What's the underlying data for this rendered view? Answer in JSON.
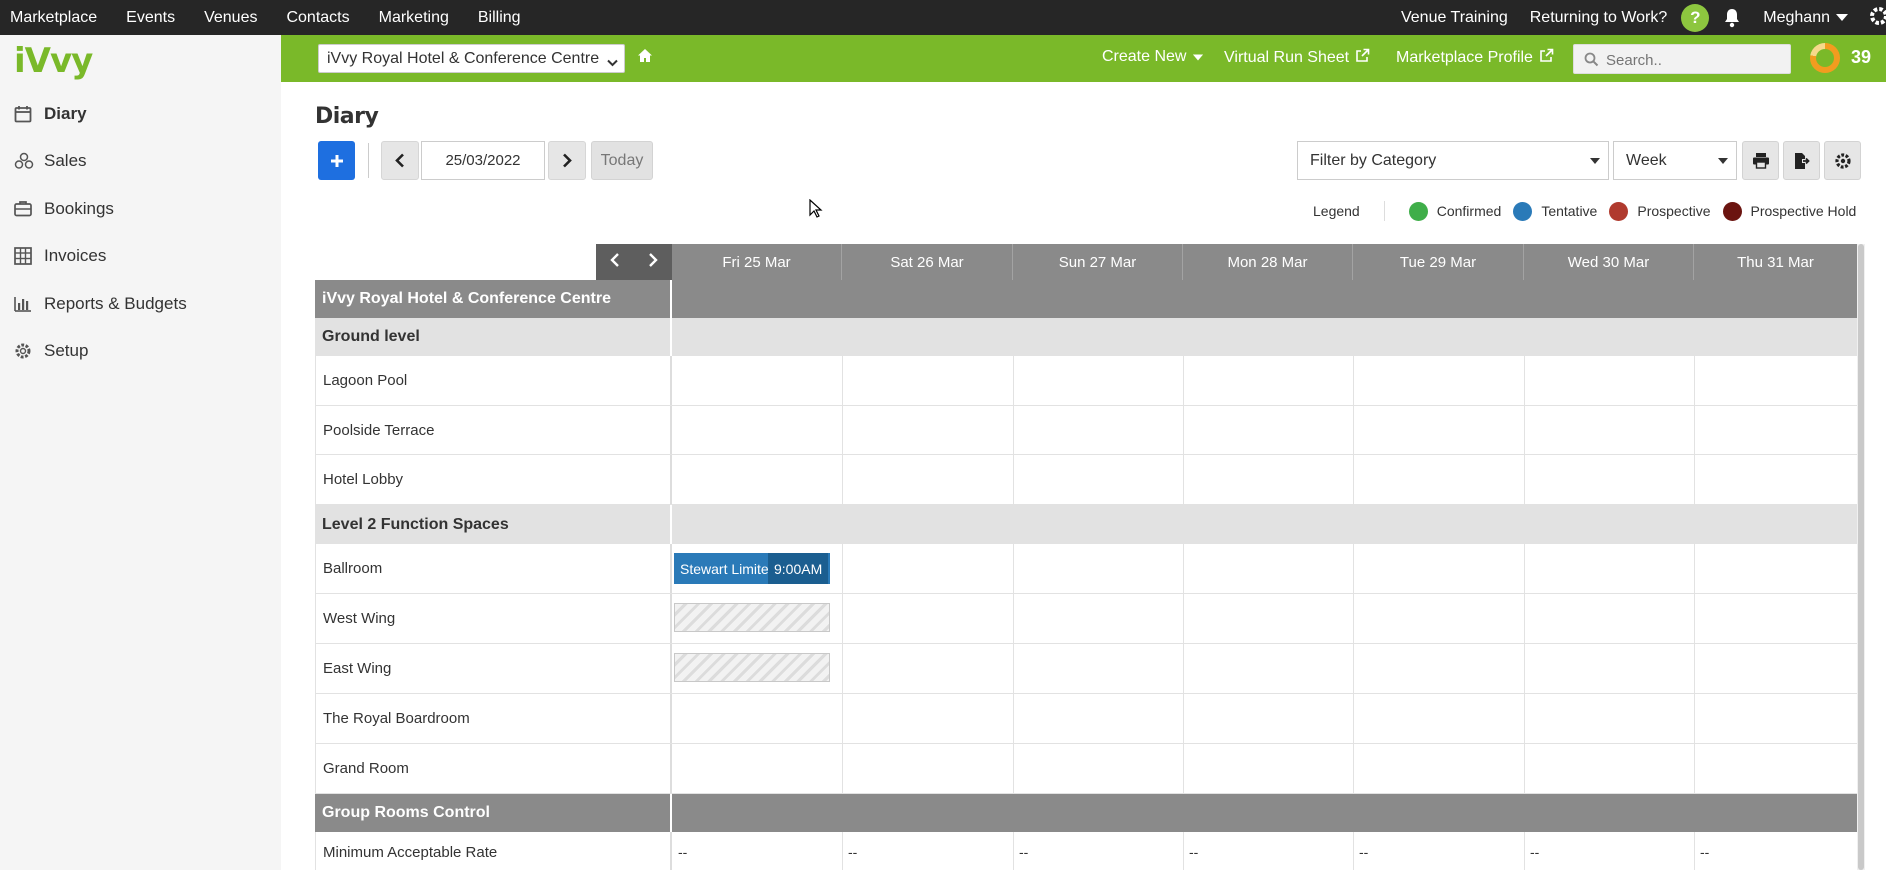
{
  "topnav": {
    "items": [
      "Marketplace",
      "Events",
      "Venues",
      "Contacts",
      "Marketing",
      "Billing"
    ],
    "venue_training": "Venue Training",
    "returning": "Returning to Work?",
    "help": "?",
    "user": "Meghann"
  },
  "sidebar": {
    "logo": "iVvy",
    "items": [
      {
        "label": "Diary",
        "icon": "calendar-icon",
        "active": true
      },
      {
        "label": "Sales",
        "icon": "sales-icon"
      },
      {
        "label": "Bookings",
        "icon": "briefcase-icon"
      },
      {
        "label": "Invoices",
        "icon": "table-icon"
      },
      {
        "label": "Reports & Budgets",
        "icon": "bar-chart-icon"
      },
      {
        "label": "Setup",
        "icon": "gear-icon"
      }
    ]
  },
  "header": {
    "venue": "iVvy Royal Hotel & Conference Centre",
    "create_new": "Create New",
    "run_sheet": "Virtual Run Sheet",
    "marketplace_profile": "Marketplace Profile",
    "search_placeholder": "Search..",
    "score": "39"
  },
  "page": {
    "title": "Diary",
    "date": "25/03/2022",
    "today": "Today",
    "filter": "Filter by Category",
    "view": "Week"
  },
  "legend": {
    "label": "Legend",
    "entries": [
      {
        "label": "Confirmed",
        "color": "#3fae49"
      },
      {
        "label": "Tentative",
        "color": "#2a7ab8"
      },
      {
        "label": "Prospective",
        "color": "#b03a2e"
      },
      {
        "label": "Prospective Hold",
        "color": "#6b1410"
      }
    ]
  },
  "calendar": {
    "days": [
      "Fri 25 Mar",
      "Sat 26 Mar",
      "Sun 27 Mar",
      "Mon 28 Mar",
      "Tue 29 Mar",
      "Wed 30 Mar",
      "Thu 31 Mar"
    ],
    "venue": "iVvy Royal Hotel & Conference Centre",
    "group1": "Ground level",
    "rooms1": [
      "Lagoon Pool",
      "Poolside Terrace",
      "Hotel Lobby"
    ],
    "group2": "Level 2 Function Spaces",
    "rooms2": [
      "Ballroom",
      "West Wing",
      "East Wing",
      "The Royal Boardroom",
      "Grand Room"
    ],
    "control": "Group Rooms Control",
    "rate_label": "Minimum Acceptable Rate",
    "rate_values": [
      "--",
      "--",
      "--",
      "--",
      "--",
      "--",
      "--"
    ],
    "booking": {
      "name": "Stewart Limited",
      "time": "9:00AM"
    }
  }
}
